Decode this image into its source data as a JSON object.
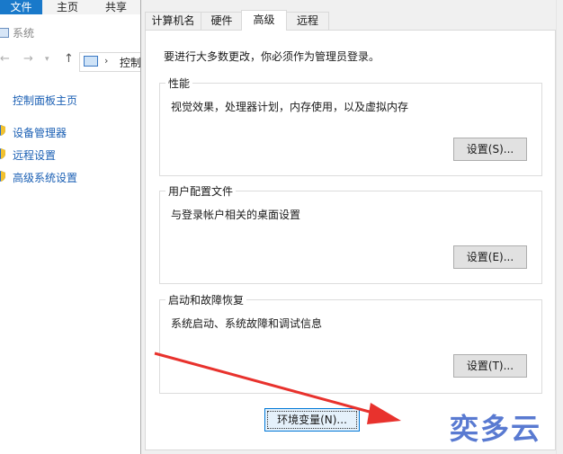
{
  "explorer": {
    "ribbon_tabs": [
      "文件",
      "主页",
      "共享"
    ],
    "window_title": "系统",
    "address_crumb": "控制",
    "side_home": "控制面板主页",
    "side_links": [
      "设备管理器",
      "远程设置",
      "高级系统设置"
    ]
  },
  "dialog": {
    "tabs": [
      "计算机名",
      "硬件",
      "高级",
      "远程"
    ],
    "active_tab": "高级",
    "admin_note": "要进行大多数更改，你必须作为管理员登录。",
    "groups": [
      {
        "title": "性能",
        "desc": "视觉效果，处理器计划，内存使用，以及虚拟内存",
        "button": "设置(S)..."
      },
      {
        "title": "用户配置文件",
        "desc": "与登录帐户相关的桌面设置",
        "button": "设置(E)..."
      },
      {
        "title": "启动和故障恢复",
        "desc": "系统启动、系统故障和调试信息",
        "button": "设置(T)..."
      }
    ],
    "env_button": "环境变量(N)..."
  },
  "watermark": "奕多云",
  "colors": {
    "accent": "#0078d7",
    "link": "#1a5fb4",
    "arrow": "#e8322d",
    "file_tab": "#1979ca"
  }
}
